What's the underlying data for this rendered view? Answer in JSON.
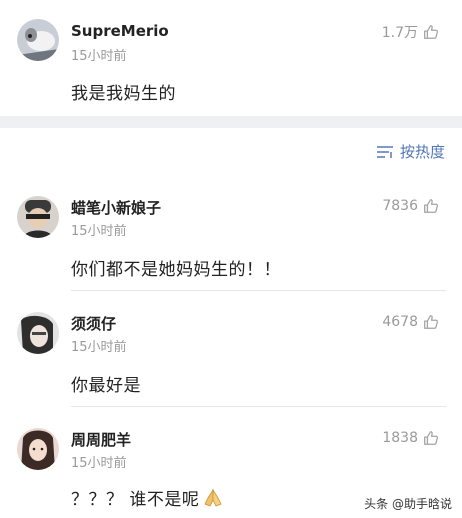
{
  "top_comment": {
    "username": "SupreMerio",
    "time": "15小时前",
    "text": "我是我妈生的",
    "likes": "1.7万"
  },
  "sort": {
    "label": "按热度",
    "icon": "sort-lines-icon"
  },
  "replies": [
    {
      "username": "蜡笔小新娘子",
      "time": "15小时前",
      "text": "你们都不是她妈妈生的！！",
      "likes": "7836"
    },
    {
      "username": "须须仔",
      "time": "15小时前",
      "text": "你最好是",
      "likes": "4678"
    },
    {
      "username": "周周肥羊",
      "time": "15小时前",
      "text": "？？？ 谁不是呢",
      "likes": "1838",
      "emoji": "praying-hands"
    }
  ],
  "watermark": "头条 @助手晗说",
  "colors": {
    "accent": "#5277b8",
    "meta": "#9a9a9a",
    "separator": "#eef0f3"
  }
}
